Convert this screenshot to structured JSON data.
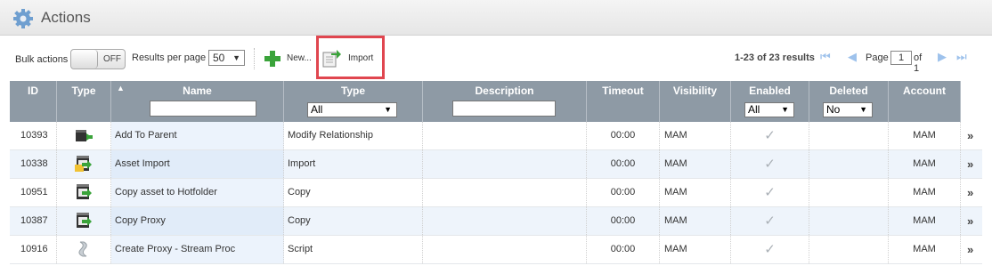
{
  "titlebar": {
    "title": "Actions",
    "icon": "gear-icon"
  },
  "toolbar": {
    "bulk_label": "Bulk actions",
    "toggle_state": "OFF",
    "rpp_label": "Results per page",
    "rpp_value": "50",
    "new_label": "New...",
    "import_label": "Import",
    "results_text": "1-23 of 23 results",
    "page_label": "Page",
    "page_value": "1",
    "page_of": "of 1"
  },
  "columns": {
    "id": "ID",
    "type_icon": "Type",
    "name": "Name",
    "type": "Type",
    "description": "Description",
    "timeout": "Timeout",
    "visibility": "Visibility",
    "enabled": "Enabled",
    "deleted": "Deleted",
    "account": "Account"
  },
  "filters": {
    "type_value": "All",
    "enabled_value": "All",
    "deleted_value": "No"
  },
  "rows": [
    {
      "id": "10393",
      "icon": "add-to-parent-icon",
      "name": "Add To Parent",
      "type": "Modify Relationship",
      "description": "",
      "timeout": "00:00",
      "visibility": "MAM",
      "enabled": "✓",
      "deleted": "",
      "account": "MAM"
    },
    {
      "id": "10338",
      "icon": "asset-import-icon",
      "name": "Asset Import",
      "type": "Import",
      "description": "",
      "timeout": "00:00",
      "visibility": "MAM",
      "enabled": "✓",
      "deleted": "",
      "account": "MAM"
    },
    {
      "id": "10951",
      "icon": "copy-icon",
      "name": "Copy asset to Hotfolder",
      "type": "Copy",
      "description": "",
      "timeout": "00:00",
      "visibility": "MAM",
      "enabled": "✓",
      "deleted": "",
      "account": "MAM"
    },
    {
      "id": "10387",
      "icon": "copy-icon",
      "name": "Copy Proxy",
      "type": "Copy",
      "description": "",
      "timeout": "00:00",
      "visibility": "MAM",
      "enabled": "✓",
      "deleted": "",
      "account": "MAM"
    },
    {
      "id": "10916",
      "icon": "script-icon",
      "name": "Create Proxy - Stream Proc",
      "type": "Script",
      "description": "",
      "timeout": "00:00",
      "visibility": "MAM",
      "enabled": "✓",
      "deleted": "",
      "account": "MAM"
    }
  ],
  "colors": {
    "header_bg": "#8e9aa5",
    "row_alt": "#eef4fb",
    "highlight": "#e0464f",
    "accent_green": "#3aa33a",
    "pager_blue": "#9ec2ec"
  }
}
